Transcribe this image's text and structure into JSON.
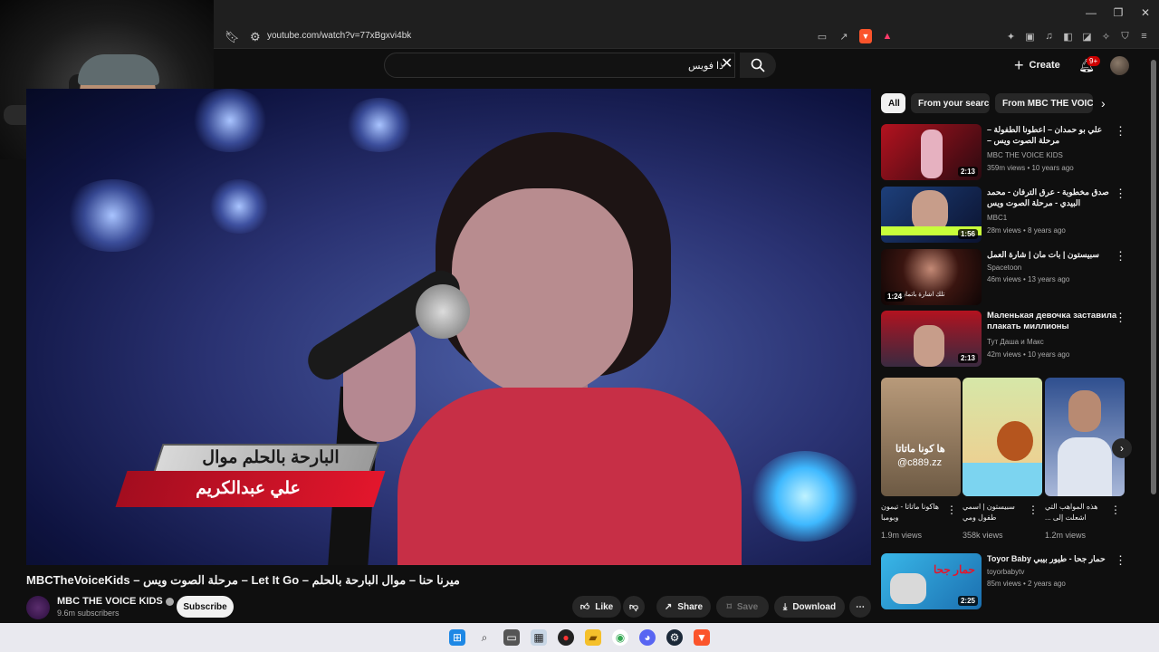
{
  "browser": {
    "url": "youtube.com/watch?v=77xBgxvi4bk",
    "window_controls": {
      "minimize": "—",
      "maximize": "❐",
      "close": "✕"
    }
  },
  "youtube_header": {
    "search_query": "ذا فويس",
    "create_label": "Create",
    "notification_count": "9+"
  },
  "video": {
    "banner_line1": "البارحة بالحلم موال",
    "banner_line2": "علي عبدالكريم",
    "title": "MBCTheVoiceKids – مرحلة الصوت ويس – Let It Go – ميرنا حنا – موال البارحة بالحلم",
    "channel": "MBC THE VOICE KIDS",
    "subscribers": "9.6m subscribers",
    "subscribe_label": "Subscribe",
    "actions": {
      "like": "Like",
      "share": "Share",
      "save": "Save",
      "download": "Download"
    }
  },
  "chips": [
    "All",
    "From your search",
    "From MBC THE VOICE KIDS"
  ],
  "recommendations": [
    {
      "title": "علي بو حمدان – اعطونا الطفولة – مرحلة الصوت ويس – MBCTheVoiceKids",
      "channel": "MBC THE VOICE KIDS",
      "meta": "359m views • 10 years ago",
      "duration": "2:13",
      "colors": [
        "#b3121f",
        "#2a0a10"
      ]
    },
    {
      "title": "صدق مخطوبة - عرق الترفان - محمد البيدي - مرحلة الصوت ويس",
      "channel": "MBC1",
      "meta": "28m views • 8 years ago",
      "duration": "1:56",
      "colors": [
        "#1d3f7a",
        "#0b1330"
      ]
    },
    {
      "title": "سبيستون | بات مان | شارة العمل",
      "channel": "Spacetoon",
      "meta": "46m views • 13 years ago",
      "duration": "1:24",
      "thumb_text": "تلك اشارة باتمان",
      "colors": [
        "#3a1510",
        "#0e0505"
      ]
    },
    {
      "title": "Маленькая девочка заставила плакать миллионы",
      "channel": "Тут Даша и Макс",
      "meta": "42m views • 10 years ago",
      "duration": "2:13",
      "colors": [
        "#8b1a2a",
        "#3a2a40"
      ]
    }
  ],
  "shorts": [
    {
      "title": "هاكونا ماتاتا - تيمون وبومبا",
      "views": "1.9m views",
      "thumb_text": "ها كونا ماتاتا",
      "thumb_sub": "@c889.zz",
      "colors": [
        "#b89a7a",
        "#6d5a44"
      ]
    },
    {
      "title": "سبيستون | اسمي طفول ومي",
      "views": "358k views",
      "colors": [
        "#d6e7a8",
        "#f4c98a"
      ]
    },
    {
      "title": "هذه المواهب التي اشعلت إلى ...",
      "views": "1.2m views",
      "colors": [
        "#2f4f8f",
        "#a9b8d9"
      ]
    }
  ],
  "last_recommendation": {
    "title": "حمار جحا - طيور بيبي Toyor Baby",
    "channel": "toyorbabytv",
    "meta": "85m views • 2 years ago",
    "duration": "2:25",
    "thumb_text": "حمار جحا",
    "colors": [
      "#39b7e8",
      "#1b6fb0"
    ]
  }
}
